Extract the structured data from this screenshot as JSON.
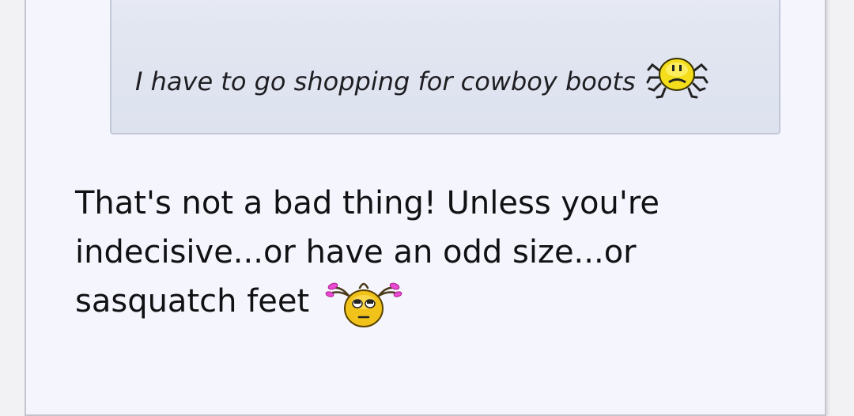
{
  "quote": {
    "text": "I have to go shopping for cowboy boots",
    "emoticon": "sad-spider-smiley-icon"
  },
  "reply": {
    "lines": [
      "That's not a bad thing! Unless you're",
      "indecisive...or have an odd size...or",
      "sasquatch feet"
    ],
    "emoticon": "rolling-eyes-pigtails-smiley-icon"
  },
  "colors": {
    "post_background": "#f5f6fd",
    "quote_background": "#e2e6f1",
    "quote_border": "#c2c8d8",
    "smiley_yellow": "#f2d21a",
    "ribbon_pink": "#e84ad0"
  }
}
